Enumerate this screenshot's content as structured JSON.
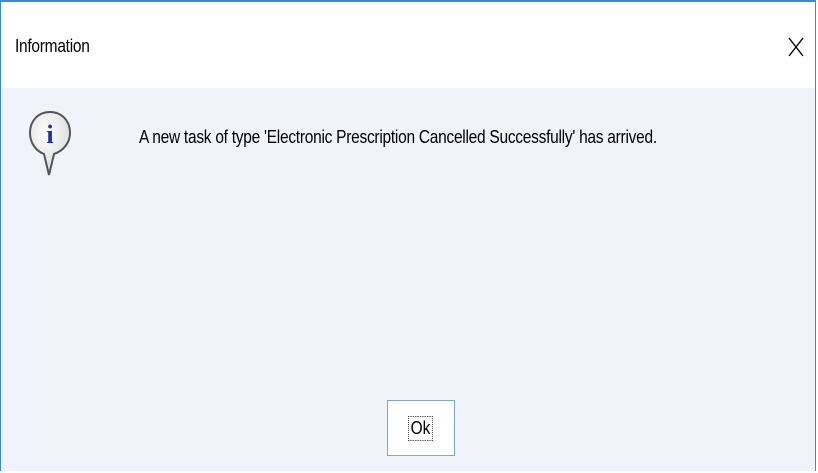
{
  "dialog": {
    "title": "Information",
    "close_label": "X",
    "icon": "info-icon",
    "message": "A new task of type 'Electronic Prescription Cancelled Successfully' has arrived.",
    "ok_label": "Ok"
  },
  "colors": {
    "border": "#3c8ad6",
    "body_bg": "#f0f4fa",
    "button_border": "#7aa7d6"
  }
}
